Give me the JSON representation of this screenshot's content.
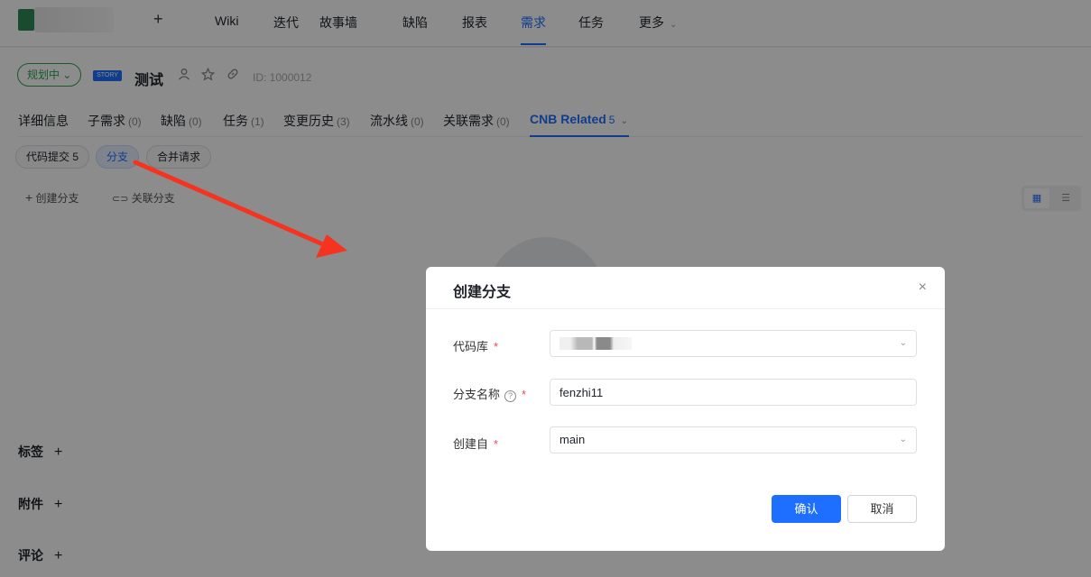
{
  "topnav": {
    "add_label": "+",
    "items": [
      "Wiki",
      "迭代",
      "故事墙",
      "缺陷",
      "报表",
      "需求",
      "任务",
      "更多"
    ],
    "more_chevron": "⌄"
  },
  "item": {
    "status": "规划中",
    "status_chevron": "⌄",
    "type_tag": "STORY",
    "title": "测试",
    "id_text": "ID: 1000012"
  },
  "tabs": [
    {
      "label": "详细信息",
      "count": ""
    },
    {
      "label": "子需求",
      "count": "(0)"
    },
    {
      "label": "缺陷",
      "count": "(0)"
    },
    {
      "label": "任务",
      "count": "(1)"
    },
    {
      "label": "变更历史",
      "count": "(3)"
    },
    {
      "label": "流水线",
      "count": "(0)"
    },
    {
      "label": "关联需求",
      "count": "(0)"
    },
    {
      "label": "CNB Related",
      "count": "5"
    }
  ],
  "chips": [
    "代码提交 5",
    "分支",
    "合并请求"
  ],
  "actions": {
    "create_branch": "创建分支",
    "link_branch": "关联分支"
  },
  "sections": [
    "标签",
    "附件",
    "评论"
  ],
  "dialog": {
    "title": "创建分支",
    "close": "×",
    "repo_label": "代码库",
    "branch_name_label": "分支名称",
    "branch_name_value": "fenzhi11",
    "created_from_label": "创建自",
    "created_from_value": "main",
    "required_mark": "*",
    "help_mark": "?",
    "confirm": "确认",
    "cancel": "取消"
  },
  "colors": {
    "accent": "#1e6fff",
    "status_green": "#2ea44f",
    "arrow_red": "#f5331f"
  }
}
